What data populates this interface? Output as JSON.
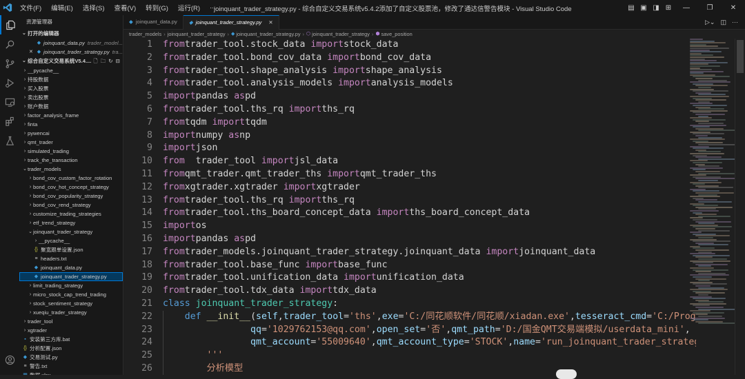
{
  "titlebar": {
    "menus": [
      "文件(F)",
      "编辑(E)",
      "选择(S)",
      "查看(V)",
      "转到(G)",
      "运行(R)",
      "..."
    ],
    "window_title": "joinquant_trader_strategy.py - 综合自定义交易系统v5.4.2添加了自定义股票池，修改了通达信警告模块 - Visual Studio Code"
  },
  "activity_bar": [
    "explorer-icon",
    "search-icon",
    "source-control-icon",
    "run-debug-icon",
    "remote-explorer-icon",
    "extensions-icon",
    "testing-icon",
    "account-icon"
  ],
  "sidebar": {
    "header": "资源管理器",
    "open_editors_label": "打开的编辑器",
    "open_editors": [
      {
        "name": "joinquant_data.py",
        "hint": "trader_model..."
      },
      {
        "name": "joinquant_trader_strategy.py",
        "hint": "tra..."
      }
    ],
    "workspace_label": "综合自定义交易系统V5.4....",
    "tree": [
      {
        "label": "__pycache__",
        "depth": 1,
        "type": "folder",
        "open": false
      },
      {
        "label": "持股数据",
        "depth": 1,
        "type": "folder",
        "open": false
      },
      {
        "label": "买入股票",
        "depth": 1,
        "type": "folder",
        "open": false
      },
      {
        "label": "卖出股票",
        "depth": 1,
        "type": "folder",
        "open": false
      },
      {
        "label": "账户数据",
        "depth": 1,
        "type": "folder",
        "open": false
      },
      {
        "label": "factor_analysis_frame",
        "depth": 1,
        "type": "folder",
        "open": false
      },
      {
        "label": "finta",
        "depth": 1,
        "type": "folder",
        "open": false
      },
      {
        "label": "pywencai",
        "depth": 1,
        "type": "folder",
        "open": false
      },
      {
        "label": "qmt_trader",
        "depth": 1,
        "type": "folder",
        "open": false
      },
      {
        "label": "simulated_trading",
        "depth": 1,
        "type": "folder",
        "open": false
      },
      {
        "label": "track_the_transaction",
        "depth": 1,
        "type": "folder",
        "open": false
      },
      {
        "label": "trader_models",
        "depth": 1,
        "type": "folder",
        "open": true
      },
      {
        "label": "bond_cov_custom_factor_rotation",
        "depth": 2,
        "type": "folder",
        "open": false
      },
      {
        "label": "bond_cov_hot_concept_strategy",
        "depth": 2,
        "type": "folder",
        "open": false
      },
      {
        "label": "bond_cov_popularity_strategy",
        "depth": 2,
        "type": "folder",
        "open": false
      },
      {
        "label": "bond_cov_rend_strategy",
        "depth": 2,
        "type": "folder",
        "open": false
      },
      {
        "label": "customize_trading_strategies",
        "depth": 2,
        "type": "folder",
        "open": false
      },
      {
        "label": "etf_trend_strategy",
        "depth": 2,
        "type": "folder",
        "open": false
      },
      {
        "label": "joinquant_trader_strategy",
        "depth": 2,
        "type": "folder",
        "open": true
      },
      {
        "label": "__pycache__",
        "depth": 3,
        "type": "folder",
        "open": false
      },
      {
        "label": "聚宽跟单设置.json",
        "depth": 3,
        "type": "json"
      },
      {
        "label": "headers.txt",
        "depth": 3,
        "type": "txt"
      },
      {
        "label": "joinquant_data.py",
        "depth": 3,
        "type": "py"
      },
      {
        "label": "joinquant_trader_strategy.py",
        "depth": 3,
        "type": "py",
        "selected": true
      },
      {
        "label": "limit_trading_strategy",
        "depth": 2,
        "type": "folder",
        "open": false
      },
      {
        "label": "micro_stock_cap_trend_trading",
        "depth": 2,
        "type": "folder",
        "open": false
      },
      {
        "label": "stock_sentiment_strategy",
        "depth": 2,
        "type": "folder",
        "open": false
      },
      {
        "label": "xueqiu_trader_strategy",
        "depth": 2,
        "type": "folder",
        "open": false
      },
      {
        "label": "trader_tool",
        "depth": 1,
        "type": "folder",
        "open": false
      },
      {
        "label": "xgtrader",
        "depth": 1,
        "type": "folder",
        "open": false
      },
      {
        "label": "安装第三方库.bat",
        "depth": 1,
        "type": "bat"
      },
      {
        "label": "分析配置.json",
        "depth": 1,
        "type": "json"
      },
      {
        "label": "交易测试.py",
        "depth": 1,
        "type": "py"
      },
      {
        "label": "警告.txt",
        "depth": 1,
        "type": "txt"
      },
      {
        "label": "数据.xlsx",
        "depth": 1,
        "type": "xlsx"
      }
    ]
  },
  "tabs": [
    {
      "label": "joinquant_data.py",
      "active": false
    },
    {
      "label": "joinquant_trader_strategy.py",
      "active": true
    }
  ],
  "breadcrumb": [
    "trader_models",
    "joinquant_trader_strategy",
    "joinquant_trader_strategy.py",
    "joinquant_trader_strategy",
    "save_position"
  ],
  "code_lines": [
    {
      "n": "1",
      "tokens": [
        [
          "kw",
          "from"
        ],
        [
          "",
          "trader_tool.stock_data "
        ],
        [
          "kw",
          "import"
        ],
        [
          "",
          "stock_data"
        ]
      ]
    },
    {
      "n": "2",
      "tokens": [
        [
          "kw",
          "from"
        ],
        [
          "",
          "trader_tool.bond_cov_data "
        ],
        [
          "kw",
          "import"
        ],
        [
          "",
          "bond_cov_data"
        ]
      ]
    },
    {
      "n": "3",
      "tokens": [
        [
          "kw",
          "from"
        ],
        [
          "",
          "trader_tool.shape_analysis "
        ],
        [
          "kw",
          "import"
        ],
        [
          "",
          "shape_analysis"
        ]
      ]
    },
    {
      "n": "4",
      "tokens": [
        [
          "kw",
          "from"
        ],
        [
          "",
          "trader_tool.analysis_models "
        ],
        [
          "kw",
          "import"
        ],
        [
          "",
          "analysis_models"
        ]
      ]
    },
    {
      "n": "5",
      "tokens": [
        [
          "kw",
          "import"
        ],
        [
          "",
          "pandas "
        ],
        [
          "kw",
          "as"
        ],
        [
          "",
          "pd"
        ]
      ]
    },
    {
      "n": "6",
      "tokens": [
        [
          "kw",
          "from"
        ],
        [
          "",
          "trader_tool.ths_rq "
        ],
        [
          "kw",
          "import"
        ],
        [
          "",
          "ths_rq"
        ]
      ]
    },
    {
      "n": "7",
      "tokens": [
        [
          "kw",
          "from"
        ],
        [
          "",
          "tqdm "
        ],
        [
          "kw",
          "import"
        ],
        [
          "",
          "tqdm"
        ]
      ]
    },
    {
      "n": "8",
      "tokens": [
        [
          "kw",
          "import"
        ],
        [
          "",
          "numpy "
        ],
        [
          "kw",
          "as"
        ],
        [
          "",
          "np"
        ]
      ]
    },
    {
      "n": "9",
      "tokens": [
        [
          "kw",
          "import"
        ],
        [
          "",
          "json"
        ]
      ]
    },
    {
      "n": "10",
      "tokens": [
        [
          "kw",
          "from"
        ],
        [
          "",
          "  trader_tool "
        ],
        [
          "kw",
          "import"
        ],
        [
          "",
          "jsl_data"
        ]
      ]
    },
    {
      "n": "11",
      "tokens": [
        [
          "kw",
          "from"
        ],
        [
          "",
          "qmt_trader.qmt_trader_ths "
        ],
        [
          "kw",
          "import"
        ],
        [
          "",
          "qmt_trader_ths"
        ]
      ]
    },
    {
      "n": "12",
      "tokens": [
        [
          "kw",
          "from"
        ],
        [
          "",
          "xgtrader.xgtrader "
        ],
        [
          "kw",
          "import"
        ],
        [
          "",
          "xgtrader"
        ]
      ]
    },
    {
      "n": "13",
      "tokens": [
        [
          "kw",
          "from"
        ],
        [
          "",
          "trader_tool.ths_rq "
        ],
        [
          "kw",
          "import"
        ],
        [
          "",
          "ths_rq"
        ]
      ]
    },
    {
      "n": "14",
      "tokens": [
        [
          "kw",
          "from"
        ],
        [
          "",
          "trader_tool.ths_board_concept_data "
        ],
        [
          "kw",
          "import"
        ],
        [
          "",
          "ths_board_concept_data"
        ]
      ]
    },
    {
      "n": "15",
      "tokens": [
        [
          "kw",
          "import"
        ],
        [
          "",
          "os"
        ]
      ]
    },
    {
      "n": "16",
      "tokens": [
        [
          "kw",
          "import"
        ],
        [
          "",
          "pandas "
        ],
        [
          "kw",
          "as"
        ],
        [
          "",
          "pd"
        ]
      ]
    },
    {
      "n": "17",
      "tokens": [
        [
          "kw",
          "from"
        ],
        [
          "",
          "trader_models.joinquant_trader_strategy.joinquant_data "
        ],
        [
          "kw",
          "import"
        ],
        [
          "",
          "joinquant_data"
        ]
      ]
    },
    {
      "n": "18",
      "tokens": [
        [
          "kw",
          "from"
        ],
        [
          "",
          "trader_tool.base_func "
        ],
        [
          "kw",
          "import"
        ],
        [
          "",
          "base_func"
        ]
      ]
    },
    {
      "n": "19",
      "tokens": [
        [
          "kw",
          "from"
        ],
        [
          "",
          "trader_tool.unification_data "
        ],
        [
          "kw",
          "import"
        ],
        [
          "",
          "unification_data"
        ]
      ]
    },
    {
      "n": "20",
      "tokens": [
        [
          "kw",
          "from"
        ],
        [
          "",
          "trader_tool.tdx_data "
        ],
        [
          "kw",
          "import"
        ],
        [
          "",
          "tdx_data"
        ]
      ]
    },
    {
      "n": "21",
      "tokens": [
        [
          "kwb",
          "class"
        ],
        [
          "",
          " "
        ],
        [
          "cls",
          "joinquant_trader_strategy"
        ],
        [
          "",
          ":"
        ]
      ]
    },
    {
      "n": "22",
      "tokens": [
        [
          "",
          "    "
        ],
        [
          "kwb",
          "def"
        ],
        [
          "",
          " "
        ],
        [
          "fn",
          "__init__"
        ],
        [
          "",
          "("
        ],
        [
          "prm",
          "self"
        ],
        [
          "",
          ","
        ],
        [
          "prm",
          "trader_tool"
        ],
        [
          "",
          "="
        ],
        [
          "str",
          "'ths'"
        ],
        [
          "",
          ","
        ],
        [
          "prm",
          "exe"
        ],
        [
          "",
          "="
        ],
        [
          "str",
          "'C:/同花顺软件/同花顺/xiadan.exe'"
        ],
        [
          "",
          ","
        ],
        [
          "prm",
          "tesseract_cmd"
        ],
        [
          "",
          "="
        ],
        [
          "str",
          "'C:/Program"
        ]
      ]
    },
    {
      "n": "23",
      "tokens": [
        [
          "",
          "                "
        ],
        [
          "prm",
          "qq"
        ],
        [
          "",
          "="
        ],
        [
          "str",
          "'1029762153@qq.com'"
        ],
        [
          "",
          ","
        ],
        [
          "prm",
          "open_set"
        ],
        [
          "",
          "="
        ],
        [
          "str",
          "'否'"
        ],
        [
          "",
          ","
        ],
        [
          "prm",
          "qmt_path"
        ],
        [
          "",
          "="
        ],
        [
          "str",
          "'D:/国金QMT交易端模拟/userdata_mini'"
        ],
        [
          "",
          ","
        ]
      ]
    },
    {
      "n": "24",
      "tokens": [
        [
          "",
          "                "
        ],
        [
          "prm",
          "qmt_account"
        ],
        [
          "",
          "="
        ],
        [
          "str",
          "'55009640'"
        ],
        [
          "",
          ","
        ],
        [
          "prm",
          "qmt_account_type"
        ],
        [
          "",
          "="
        ],
        [
          "str",
          "'STOCK'"
        ],
        [
          "",
          ","
        ],
        [
          "prm",
          "name"
        ],
        [
          "",
          "="
        ],
        [
          "str",
          "'run_joinquant_trader_strategy'"
        ],
        [
          "",
          ")"
        ]
      ]
    },
    {
      "n": "25",
      "tokens": [
        [
          "",
          "        "
        ],
        [
          "str",
          "'''"
        ]
      ]
    },
    {
      "n": "26",
      "tokens": [
        [
          "",
          "        "
        ],
        [
          "str",
          "分析模型"
        ]
      ]
    }
  ],
  "colors": {
    "accent": "#0078d4",
    "keyword": "#c586c0",
    "keyword_blue": "#569cd6",
    "class": "#4ec9b0",
    "function": "#dcdcaa",
    "param": "#9cdcfe",
    "string": "#ce9178"
  }
}
